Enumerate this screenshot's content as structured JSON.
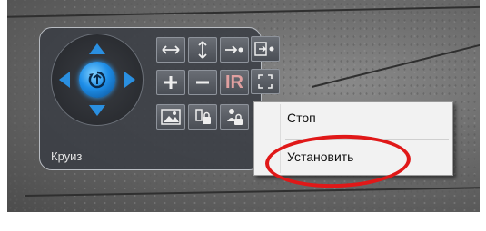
{
  "ptz_panel": {
    "label": "Круиз",
    "dpad": {
      "up_icon": "arrow-up-icon",
      "down_icon": "arrow-down-icon",
      "left_icon": "arrow-left-icon",
      "right_icon": "arrow-right-icon",
      "center_icon": "auto-rotate-icon"
    },
    "tools": [
      {
        "icon": "horizontal-scan-icon"
      },
      {
        "icon": "vertical-scan-icon"
      },
      {
        "icon": "go-to-preset-icon"
      },
      {
        "icon": "exit-preset-icon"
      },
      {
        "icon": "zoom-in-icon"
      },
      {
        "icon": "zoom-out-icon"
      },
      {
        "icon": "infrared-icon",
        "text": "IR"
      },
      {
        "icon": "fullscreen-icon"
      },
      {
        "icon": "picture-icon"
      },
      {
        "icon": "record-lock-icon"
      },
      {
        "icon": "person-lock-icon"
      }
    ]
  },
  "context_menu": {
    "items": [
      {
        "label": "Стоп"
      },
      {
        "label": "Установить"
      }
    ]
  },
  "colors": {
    "accent": "#2a8fe0",
    "highlight_ring": "#e01818",
    "ir_text": "#e0a0a0"
  }
}
